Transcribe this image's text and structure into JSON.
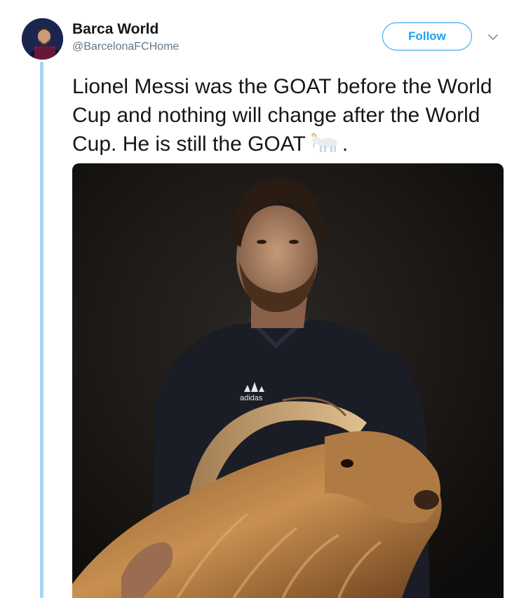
{
  "tweet": {
    "display_name": "Barca World",
    "handle": "@BarcelonaFCHome",
    "follow_label": "Follow",
    "text": "Lionel Messi was the GOAT before the World Cup and nothing will change after the World Cup. He is still the GOAT",
    "text_suffix": ".",
    "emoji_icon": "goat-emoji-icon",
    "image_logo_text": "adidas"
  },
  "colors": {
    "accent": "#1da1f2",
    "thread_line": "#a3d5f5",
    "text": "#14171a",
    "muted": "#657786"
  }
}
